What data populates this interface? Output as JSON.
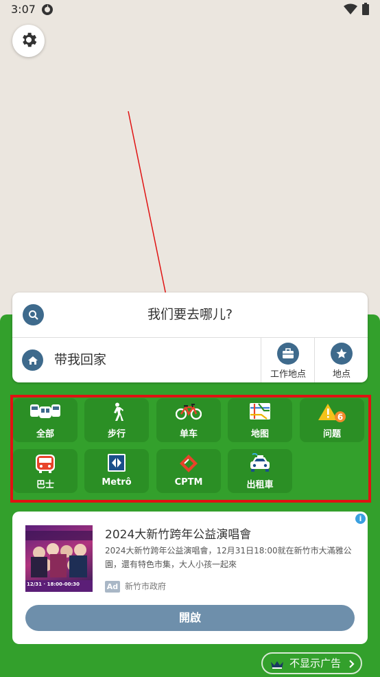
{
  "status_bar": {
    "time": "3:07"
  },
  "search": {
    "prompt": "我们要去哪儿?"
  },
  "home": {
    "label": "带我回家"
  },
  "favorites": [
    {
      "label": "工作地点",
      "icon": "briefcase-icon"
    },
    {
      "label": "地点",
      "icon": "star-icon"
    }
  ],
  "modes": [
    {
      "label": "全部",
      "icon": "all-transit-icon"
    },
    {
      "label": "步行",
      "icon": "walking-icon"
    },
    {
      "label": "单车",
      "icon": "bicycle-icon"
    },
    {
      "label": "地图",
      "icon": "subway-map-icon"
    },
    {
      "label": "问题",
      "icon": "warning-icon",
      "badge": "6"
    },
    {
      "label": "巴士",
      "icon": "bus-icon"
    },
    {
      "label": "Metrô",
      "icon": "metro-icon"
    },
    {
      "label": "CPTM",
      "icon": "cptm-icon"
    },
    {
      "label": "出租車",
      "icon": "taxi-icon"
    }
  ],
  "ad": {
    "title": "2024大新竹跨年公益演唱會",
    "description": "2024大新竹跨年公益演唱會，12月31日18:00就在新竹市大滿雅公園，還有特色市集，大人小孩一起來",
    "badge": "Ad",
    "advertiser": "新竹市政府",
    "cta": "開啟",
    "image_text": "12/31 · 18:00-00:30"
  },
  "remove_ads": {
    "label": "不显示广告"
  },
  "colors": {
    "panel_green": "#33a02c",
    "tile_green": "#2b8f25",
    "icon_blue": "#3e6a8c",
    "highlight_red": "#e01212",
    "map_background": "#ebe6df"
  }
}
